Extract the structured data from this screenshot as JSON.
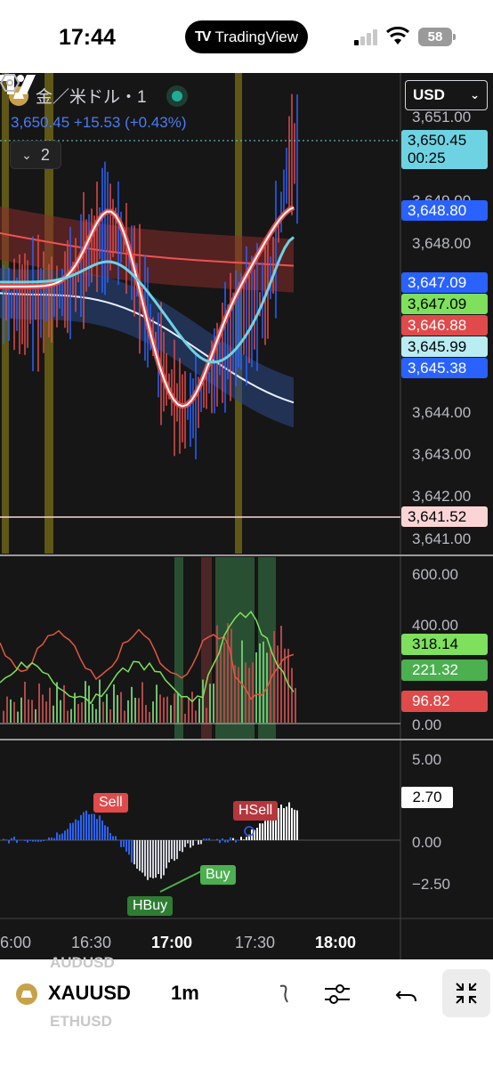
{
  "status_bar": {
    "time": "17:44",
    "app_pill": "TradingView",
    "battery": "58"
  },
  "header": {
    "symbol_title": "金／米ドル・1",
    "price_change": "3,650.45 +15.53 (+0.43%)",
    "collapse_count": "2",
    "currency": "USD"
  },
  "price_axis": {
    "ticks": [
      "3,651.00",
      "3,649.00",
      "3,648.00",
      "3,644.00",
      "3,643.00",
      "3,642.00",
      "3,641.00"
    ]
  },
  "price_tags": [
    {
      "text": "3,650.45",
      "sub": "00:25",
      "bg": "#6dd3e3",
      "fg": "#000000"
    },
    {
      "text": "3,648.80",
      "bg": "#2962ff",
      "fg": "#ffffff"
    },
    {
      "text": "3,647.09",
      "bg": "#2962ff",
      "fg": "#ffffff"
    },
    {
      "text": "3,647.09",
      "bg": "#7ee05c",
      "fg": "#000000"
    },
    {
      "text": "3,646.88",
      "bg": "#e04a4a",
      "fg": "#ffffff"
    },
    {
      "text": "3,645.99",
      "bg": "#b9ecf3",
      "fg": "#000000"
    },
    {
      "text": "3,645.38",
      "bg": "#2962ff",
      "fg": "#ffffff"
    },
    {
      "text": "3,641.52",
      "bg": "#fbd5d5",
      "fg": "#000000"
    }
  ],
  "volume_pane": {
    "ticks": [
      "600.00",
      "400.00",
      "0.00"
    ],
    "tags": [
      {
        "text": "318.14",
        "bg": "#7ee05c",
        "fg": "#000000"
      },
      {
        "text": "221.32",
        "bg": "#4caf50",
        "fg": "#ffffff"
      },
      {
        "text": "96.82",
        "bg": "#e04a4a",
        "fg": "#ffffff"
      }
    ]
  },
  "oscillator_pane": {
    "ticks": [
      "5.00",
      "0.00",
      "−2.50"
    ],
    "current_value": "2.70",
    "signals": {
      "sell": "Sell",
      "hsell": "HSell",
      "buy": "Buy",
      "hbuy": "HBuy"
    }
  },
  "time_axis": {
    "labels": [
      "6:00",
      "16:30",
      "17:00",
      "17:30",
      "18:00"
    ]
  },
  "bottom_bar": {
    "ghost_above": "AUDUSD",
    "ghost_below": "ETHUSD",
    "symbol": "XAUUSD",
    "interval": "1m"
  },
  "colors": {
    "background": "#161616",
    "accent_blue": "#2962ff",
    "bull": "#4caf50",
    "bear": "#e04a4a"
  }
}
